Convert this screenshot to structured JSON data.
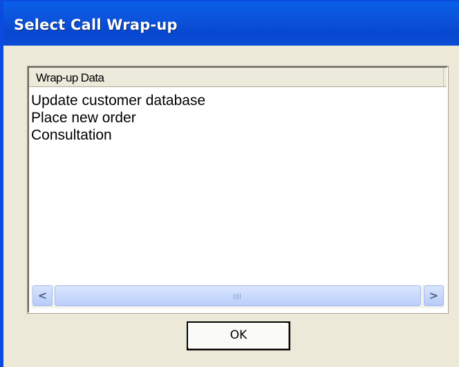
{
  "window": {
    "title": "Select Call Wrap-up"
  },
  "list": {
    "column_header": "Wrap-up Data",
    "items": [
      "Update customer database",
      "Place new order",
      "Consultation"
    ]
  },
  "scrollbar": {
    "left_icon": "arrow-left-icon",
    "right_icon": "arrow-right-icon",
    "left_glyph": "<",
    "right_glyph": ">"
  },
  "buttons": {
    "ok_label": "OK"
  },
  "colors": {
    "titlebar": "#0a4be0",
    "dialog_background": "#ece9d8",
    "scrollbar_thumb": "#c8d8fc"
  }
}
